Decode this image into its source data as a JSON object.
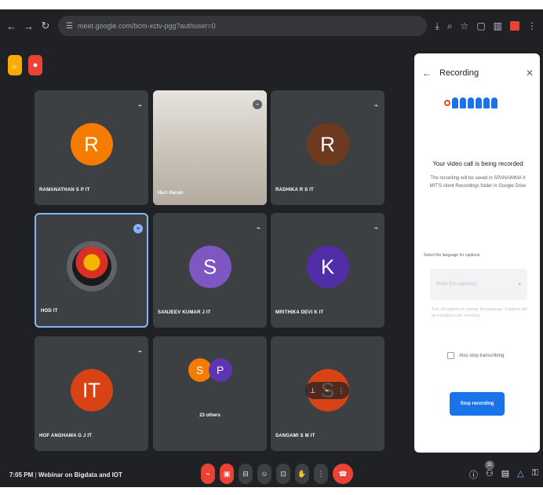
{
  "browser": {
    "url": "meet.google.com/bcm-xctv-pgg?authuser=0"
  },
  "tiles": [
    {
      "name": "RAMANATHAN S P IT",
      "initial": "R",
      "color": "#f57c00"
    },
    {
      "name": "Hari Haran",
      "video": true
    },
    {
      "name": "RADHIKA R S IT",
      "initial": "R",
      "color": "#6d3a1f"
    },
    {
      "name": "HOD IT",
      "photo": true
    },
    {
      "name": "SANJEEV KUMAR J IT",
      "initial": "S",
      "color": "#7e57c2"
    },
    {
      "name": "MRITHIKA DEVI K IT",
      "initial": "K",
      "color": "#512da8"
    },
    {
      "name": "HOF ANGHAMA G J IT",
      "initial": "IT",
      "color": "#d84315"
    },
    {
      "others_label": "23 others",
      "initials": [
        "S",
        "P"
      ],
      "colors": [
        "#f57c00",
        "#5e35b1"
      ]
    },
    {
      "name": "SANGAMI S M IT",
      "initial": "S",
      "color": "#d84315"
    }
  ],
  "panel": {
    "title": "Recording",
    "status": "Your video call is being recorded",
    "detail": "The recording will be saved in SPANAIMMA II MIT'S client Recordings folder in Google Drive",
    "language_label": "Select the language for captions",
    "language_value": "None (No captions)",
    "hint": "Turn off captions to change the language. Captions will be included in the recording",
    "transcribe_label": "Also stop transcribing",
    "stop_button": "Stop recording"
  },
  "meeting": {
    "time": "7:05 PM",
    "title": "Webinar on Bigdata and IOT",
    "participant_count": "31"
  },
  "colors": {
    "background": "#202124",
    "tile": "#3c4043",
    "accent": "#1a73e8",
    "danger": "#ea4335"
  }
}
